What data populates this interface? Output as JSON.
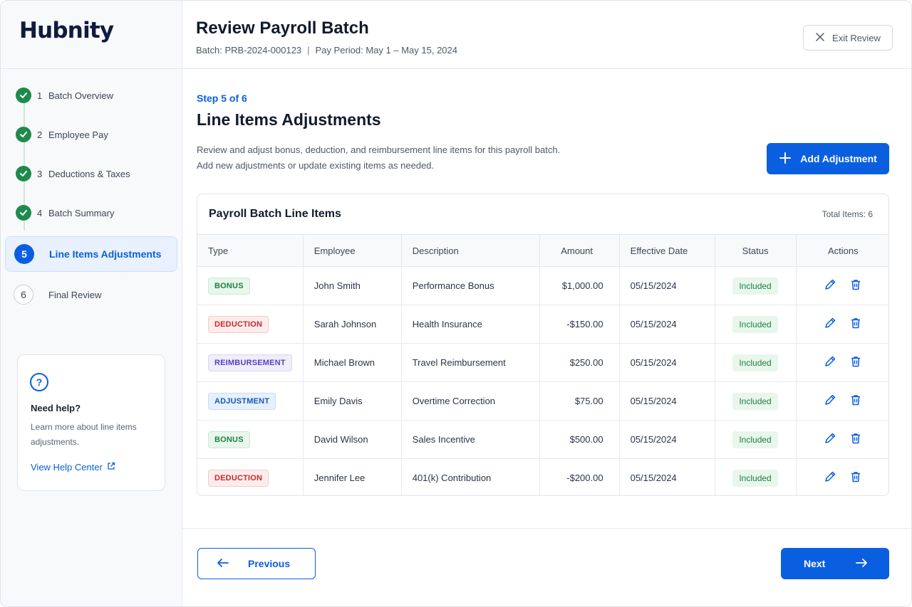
{
  "brand": {
    "logo": "Hubnity"
  },
  "header": {
    "title": "Review Payroll Batch",
    "batch": "Batch: PRB-2024-000123",
    "separator": "|",
    "pay_period": "Pay Period: May 1 – May 15, 2024",
    "exit_label": "Exit Review"
  },
  "steps": [
    {
      "num": "1",
      "label": "Batch Overview",
      "state": "done"
    },
    {
      "num": "2",
      "label": "Employee Pay",
      "state": "done"
    },
    {
      "num": "3",
      "label": "Deductions & Taxes",
      "state": "done"
    },
    {
      "num": "4",
      "label": "Batch Summary",
      "state": "done"
    },
    {
      "num": "5",
      "label": "Line Items Adjustments",
      "state": "active"
    },
    {
      "num": "6",
      "label": "Final Review",
      "state": "pending"
    }
  ],
  "help": {
    "icon": "?",
    "title": "Need help?",
    "text": "Learn more about line items adjustments.",
    "link": "View Help Center"
  },
  "main": {
    "step_count": "Step 5 of 6",
    "title": "Line Items Adjustments",
    "desc_line1": "Review and adjust bonus, deduction, and reimbursement line items for this payroll batch.",
    "desc_line2": "Add new adjustments or update existing items as needed.",
    "add_label": "Add Adjustment"
  },
  "table": {
    "title": "Payroll Batch Line Items",
    "count": "Total Items: 6",
    "headers": [
      "Type",
      "Employee",
      "Description",
      "Amount",
      "Effective Date",
      "Status",
      "Actions"
    ],
    "rows": [
      {
        "type": "BONUS",
        "kind": "bonus",
        "employee": "John Smith",
        "description": "Performance Bonus",
        "amount": "$1,000.00",
        "date": "05/15/2024",
        "status": "Included"
      },
      {
        "type": "DEDUCTION",
        "kind": "deduction",
        "employee": "Sarah Johnson",
        "description": "Health Insurance",
        "amount": "-$150.00",
        "date": "05/15/2024",
        "status": "Included"
      },
      {
        "type": "REIMBURSEMENT",
        "kind": "reimbursement",
        "employee": "Michael Brown",
        "description": "Travel Reimbursement",
        "amount": "$250.00",
        "date": "05/15/2024",
        "status": "Included"
      },
      {
        "type": "ADJUSTMENT",
        "kind": "adjustment",
        "employee": "Emily Davis",
        "description": "Overtime Correction",
        "amount": "$75.00",
        "date": "05/15/2024",
        "status": "Included"
      },
      {
        "type": "BONUS",
        "kind": "bonus",
        "employee": "David Wilson",
        "description": "Sales Incentive",
        "amount": "$500.00",
        "date": "05/15/2024",
        "status": "Included"
      },
      {
        "type": "DEDUCTION",
        "kind": "deduction",
        "employee": "Jennifer Lee",
        "description": "401(k) Contribution",
        "amount": "-$200.00",
        "date": "05/15/2024",
        "status": "Included"
      }
    ]
  },
  "footer": {
    "prev_label": "Previous",
    "next_label": "Next"
  },
  "colors": {
    "accent": "#0a5fe0",
    "success": "#1e8a4c",
    "danger": "#c62828",
    "purple": "#5a3fbf"
  },
  "icons": {
    "exit": "close-icon",
    "add": "plus-icon",
    "edit": "pencil-icon",
    "delete": "trash-icon",
    "help": "question-circle-icon",
    "external": "external-link-icon",
    "prev": "arrow-left-icon",
    "next": "arrow-right-icon",
    "done": "check-icon"
  }
}
